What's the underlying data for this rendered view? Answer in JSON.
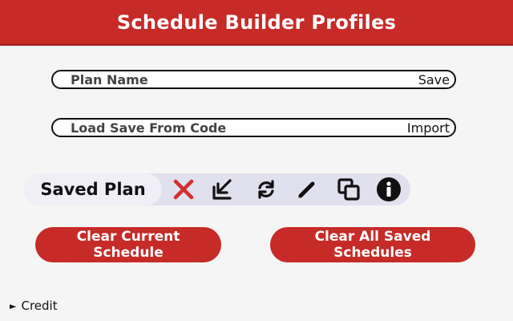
{
  "header": {
    "title": "Schedule Builder Profiles",
    "bg_color": "#c62b28"
  },
  "plan_name": {
    "placeholder": "Plan Name",
    "button_label": "Save"
  },
  "load_code": {
    "placeholder": "Load Save From Code",
    "button_label": "Import"
  },
  "saved_plan": {
    "label": "Saved Plan",
    "icons": [
      "close-icon",
      "load-icon",
      "sync-icon",
      "edit-icon",
      "copy-icon",
      "info-icon"
    ]
  },
  "actions": {
    "clear_current": "Clear Current Schedule",
    "clear_all": "Clear All Saved Schedules"
  },
  "credit": {
    "label": "Credit",
    "marker": "►"
  }
}
